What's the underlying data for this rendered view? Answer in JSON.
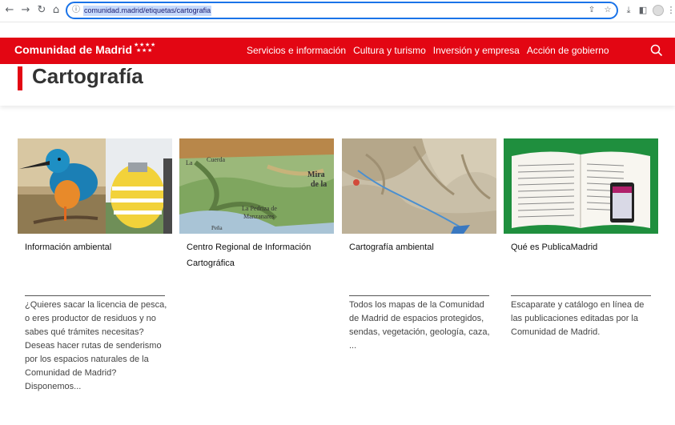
{
  "browser": {
    "url": "comunidad.madrid/etiquetas/cartografia"
  },
  "header": {
    "brand": "Comunidad de Madrid",
    "nav": [
      "Servicios e información",
      "Cultura y turismo",
      "Inversión y empresa",
      "Acción de gobierno"
    ]
  },
  "page": {
    "title": "Cartografía"
  },
  "cards": [
    {
      "title": "Información ambiental",
      "description": "¿Quieres sacar la licencia de pesca, o eres productor de residuos y no sabes qué trámites necesitas? Deseas hacer rutas de senderismo por los espacios naturales de la Comunidad de Madrid? Disponemos..."
    },
    {
      "title": "Centro Regional de Información Cartográfica",
      "description": ""
    },
    {
      "title": "Cartografía ambiental",
      "description": "Todos los mapas de la Comunidad de Madrid de espacios protegidos, sendas, vegetación, geología, caza, ..."
    },
    {
      "title": "Qué es PublicaMadrid",
      "description": "Escaparate y catálogo en línea de las publicaciones editadas por la Comunidad de Madrid."
    }
  ],
  "map_labels": [
    "La",
    "Cuerda",
    "Mira",
    "de la",
    "La Pedriza de",
    "Manzanares",
    "Peña"
  ],
  "colors": {
    "brand_red": "#e30613",
    "address_bar_focus": "#1a73e8"
  }
}
